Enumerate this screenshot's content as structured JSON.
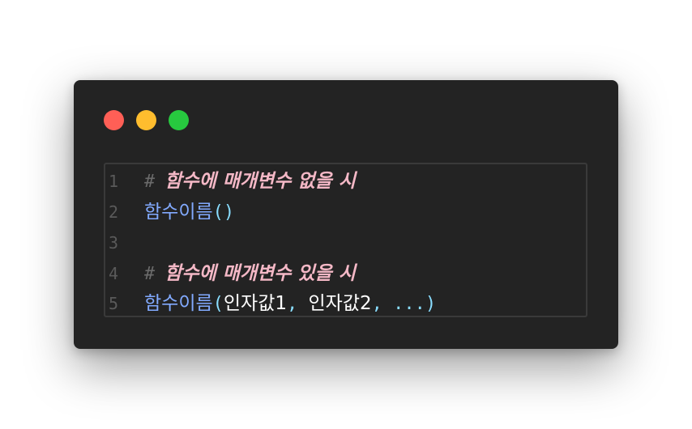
{
  "window": {
    "controls": {
      "close_color": "#ff5f56",
      "minimize_color": "#ffbd2e",
      "maximize_color": "#27c93f"
    }
  },
  "code": {
    "lines": [
      {
        "number": "1",
        "hash": "#",
        "comment": "함수에 매개변수 없을 시"
      },
      {
        "number": "2",
        "fn": "함수이름",
        "paren": "()"
      },
      {
        "number": "3"
      },
      {
        "number": "4",
        "hash": "#",
        "comment": "함수에 매개변수 있을 시"
      },
      {
        "number": "5",
        "fn": "함수이름",
        "open": "(",
        "arg1": "인자값1",
        "comma1": ",",
        "arg2": "인자값2",
        "comma2": ",",
        "ellipsis": "...",
        "close": ")"
      }
    ]
  }
}
